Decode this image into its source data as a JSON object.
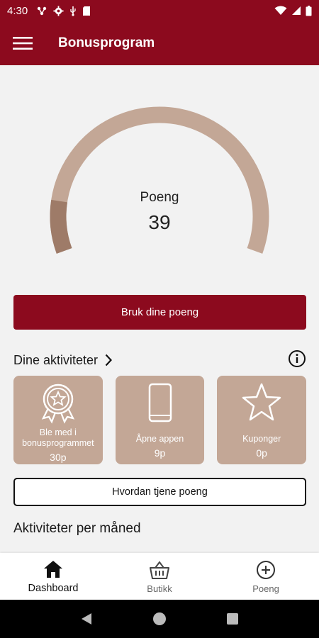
{
  "status_bar": {
    "time": "4:30",
    "left_icons": [
      "network-icon",
      "gear-icon",
      "usb-icon",
      "sd-card-icon"
    ],
    "right_icons": [
      "wifi-icon",
      "signal-icon",
      "battery-icon"
    ]
  },
  "app_bar": {
    "title": "Bonusprogram",
    "menu_icon": "hamburger-menu-icon"
  },
  "points_gauge": {
    "label": "Poeng",
    "value": "39",
    "fill_fraction": 0.13,
    "track_color": "#c3a796",
    "fill_color": "#9e7b68"
  },
  "primary_button": {
    "label": "Bruk dine poeng"
  },
  "activities": {
    "header": "Dine aktiviteter",
    "cards": [
      {
        "icon": "award-badge-icon",
        "title": "Ble med i bonusprogrammet",
        "points": "30p"
      },
      {
        "icon": "phone-icon",
        "title": "Åpne appen",
        "points": "9p"
      },
      {
        "icon": "star-icon",
        "title": "Kuponger",
        "points": "0p"
      }
    ]
  },
  "secondary_button": {
    "label": "Hvordan tjene poeng"
  },
  "monthly_section": {
    "title": "Aktiviteter per måned"
  },
  "bottom_nav": {
    "items": [
      {
        "icon": "home-icon",
        "label": "Dashboard",
        "active": true
      },
      {
        "icon": "basket-icon",
        "label": "Butikk",
        "active": false
      },
      {
        "icon": "plus-circle-icon",
        "label": "Poeng",
        "active": false
      }
    ]
  },
  "colors": {
    "brand": "#8c0a1e",
    "card": "#c3a796",
    "background": "#f2f2f2"
  }
}
